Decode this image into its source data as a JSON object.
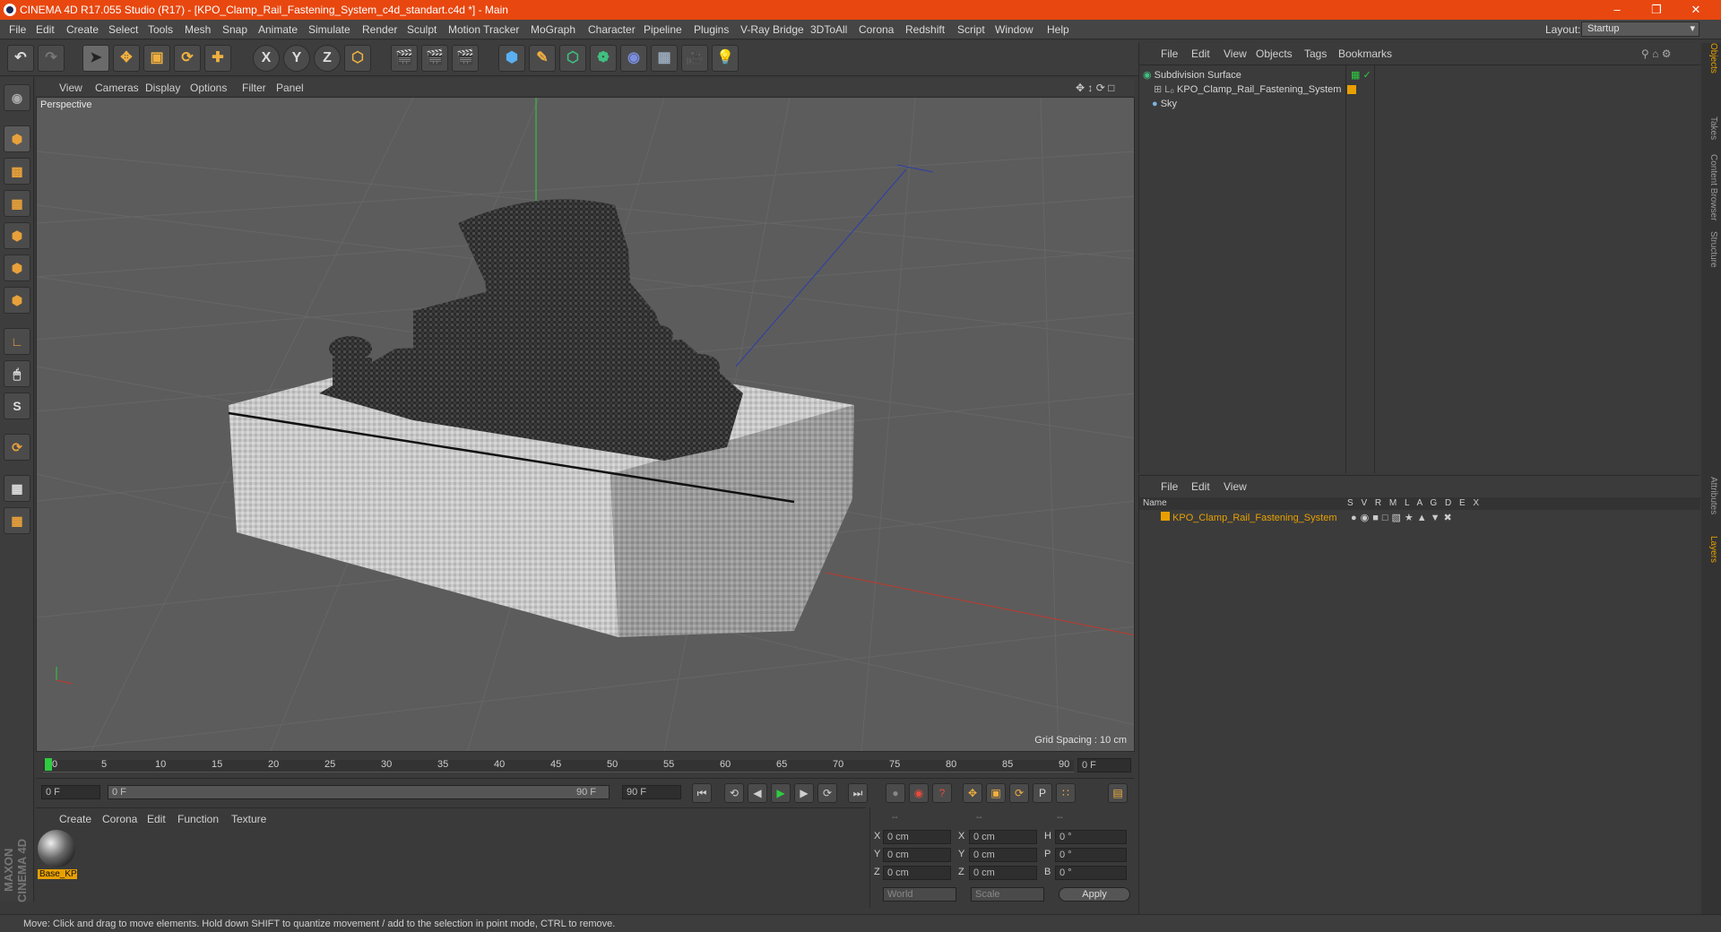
{
  "window": {
    "title": "CINEMA 4D R17.055 Studio (R17) - [KPO_Clamp_Rail_Fastening_System_c4d_standart.c4d *] - Main",
    "minimize": "–",
    "maximize": "❐",
    "close": "✕"
  },
  "menu": [
    "File",
    "Edit",
    "Create",
    "Select",
    "Tools",
    "Mesh",
    "Snap",
    "Animate",
    "Simulate",
    "Render",
    "Sculpt",
    "Motion Tracker",
    "MoGraph",
    "Character",
    "Pipeline",
    "Plugins",
    "V-Ray Bridge",
    "3DToAll",
    "Corona",
    "Redshift",
    "Script",
    "Window",
    "Help"
  ],
  "layout": {
    "label": "Layout:",
    "value": "Startup"
  },
  "toolbar": {
    "x": "X",
    "y": "Y",
    "z": "Z"
  },
  "viewport": {
    "menu": [
      "View",
      "Cameras",
      "Display",
      "Options",
      "Filter",
      "Panel"
    ],
    "label": "Perspective",
    "grid_spacing": "Grid Spacing : 10 cm"
  },
  "timeline": {
    "ticks": [
      "0",
      "5",
      "10",
      "15",
      "20",
      "25",
      "30",
      "35",
      "40",
      "45",
      "50",
      "55",
      "60",
      "65",
      "70",
      "75",
      "80",
      "85",
      "90"
    ],
    "end_frame": "0 F"
  },
  "playback": {
    "start": "0 F",
    "range_start": "0 F",
    "range_end": "90 F",
    "end": "90 F"
  },
  "materials": {
    "menu": [
      "Create",
      "Corona",
      "Edit",
      "Function",
      "Texture"
    ],
    "items": [
      {
        "name": "Base_KP"
      }
    ]
  },
  "coords": {
    "header": [
      "--",
      "--",
      "--"
    ],
    "rows": [
      {
        "a": "X",
        "av": "0 cm",
        "b": "X",
        "bv": "0 cm",
        "c": "H",
        "cv": "0 °"
      },
      {
        "a": "Y",
        "av": "0 cm",
        "b": "Y",
        "bv": "0 cm",
        "c": "P",
        "cv": "0 °"
      },
      {
        "a": "Z",
        "av": "0 cm",
        "b": "Z",
        "bv": "0 cm",
        "c": "B",
        "cv": "0 °"
      }
    ],
    "world": "World",
    "scale": "Scale",
    "apply": "Apply"
  },
  "objects": {
    "menu": [
      "File",
      "Edit",
      "View",
      "Objects",
      "Tags",
      "Bookmarks"
    ],
    "items": [
      {
        "name": "Subdivision Surface"
      },
      {
        "name": "KPO_Clamp_Rail_Fastening_System"
      },
      {
        "name": "Sky"
      }
    ]
  },
  "layers": {
    "menu": [
      "File",
      "Edit",
      "View"
    ],
    "col_name": "Name",
    "cols": [
      "S",
      "V",
      "R",
      "M",
      "L",
      "A",
      "G",
      "D",
      "E",
      "X"
    ],
    "items": [
      {
        "name": "KPO_Clamp_Rail_Fastening_System",
        "color": "#e8a000"
      }
    ]
  },
  "sidetabs": [
    "Objects",
    "Takes",
    "Content Browser",
    "Structure",
    "Attributes",
    "Layers"
  ],
  "brand": "MAXON CINEMA 4D",
  "status": "Move: Click and drag to move elements. Hold down SHIFT to quantize movement / add to the selection in point mode, CTRL to remove.",
  "colors": {
    "title_bar": "#e8470f",
    "accent": "#e8a000",
    "x_axis": "#c0392b",
    "y_axis": "#27ae60",
    "z_axis": "#2b3ea8"
  }
}
